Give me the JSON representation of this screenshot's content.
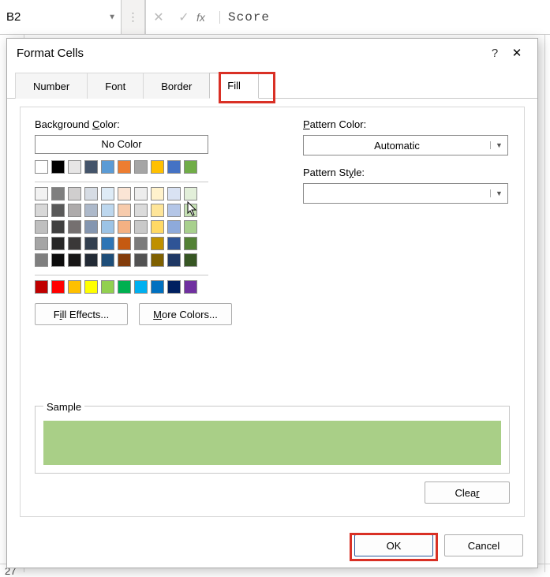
{
  "sheet": {
    "name_box": "B2",
    "fx_label": "fx",
    "formula_value": "Score",
    "visible_row": "27"
  },
  "dialog": {
    "title": "Format Cells",
    "tabs": [
      "Number",
      "Font",
      "Border",
      "Fill"
    ],
    "active_tab_index": 3,
    "bg_color_label": "Background Color:",
    "no_color_label": "No Color",
    "fill_effects_label": "Fill Effects...",
    "more_colors_label": "More Colors...",
    "pattern_color_label": "Pattern Color:",
    "pattern_color_value": "Automatic",
    "pattern_style_label": "Pattern Style:",
    "sample_label": "Sample",
    "sample_color": "#a9cf87",
    "clear_label": "Clear",
    "ok_label": "OK",
    "cancel_label": "Cancel"
  },
  "palette": {
    "theme_row1": [
      "#ffffff",
      "#000000",
      "#e7e6e6",
      "#44546a",
      "#5b9bd5",
      "#ed7d31",
      "#a5a5a5",
      "#ffc000",
      "#4472c4",
      "#70ad47"
    ],
    "theme_shades": [
      [
        "#f2f2f2",
        "#7f7f7f",
        "#d0cece",
        "#d6dce4",
        "#deebf6",
        "#fbe5d5",
        "#ededed",
        "#fff2cc",
        "#d9e2f3",
        "#e2efd9"
      ],
      [
        "#d8d8d8",
        "#595959",
        "#aeabab",
        "#adb9ca",
        "#bdd7ee",
        "#f7cbac",
        "#dbdbdb",
        "#fee599",
        "#b4c6e7",
        "#c5e0b3"
      ],
      [
        "#bfbfbf",
        "#3f3f3f",
        "#757070",
        "#8496b0",
        "#9cc3e5",
        "#f4b183",
        "#c9c9c9",
        "#ffd965",
        "#8eaadb",
        "#a8d08d"
      ],
      [
        "#a5a5a5",
        "#262626",
        "#3a3838",
        "#323f4f",
        "#2e75b5",
        "#c55a11",
        "#7b7b7b",
        "#bf9000",
        "#2f5496",
        "#538135"
      ],
      [
        "#7f7f7f",
        "#0c0c0c",
        "#171616",
        "#222a35",
        "#1e4e79",
        "#833c0b",
        "#525252",
        "#7f6000",
        "#1f3864",
        "#375623"
      ]
    ],
    "standard": [
      "#c00000",
      "#ff0000",
      "#ffc000",
      "#ffff00",
      "#92d050",
      "#00b050",
      "#00b0f0",
      "#0070c0",
      "#002060",
      "#7030a0"
    ]
  }
}
